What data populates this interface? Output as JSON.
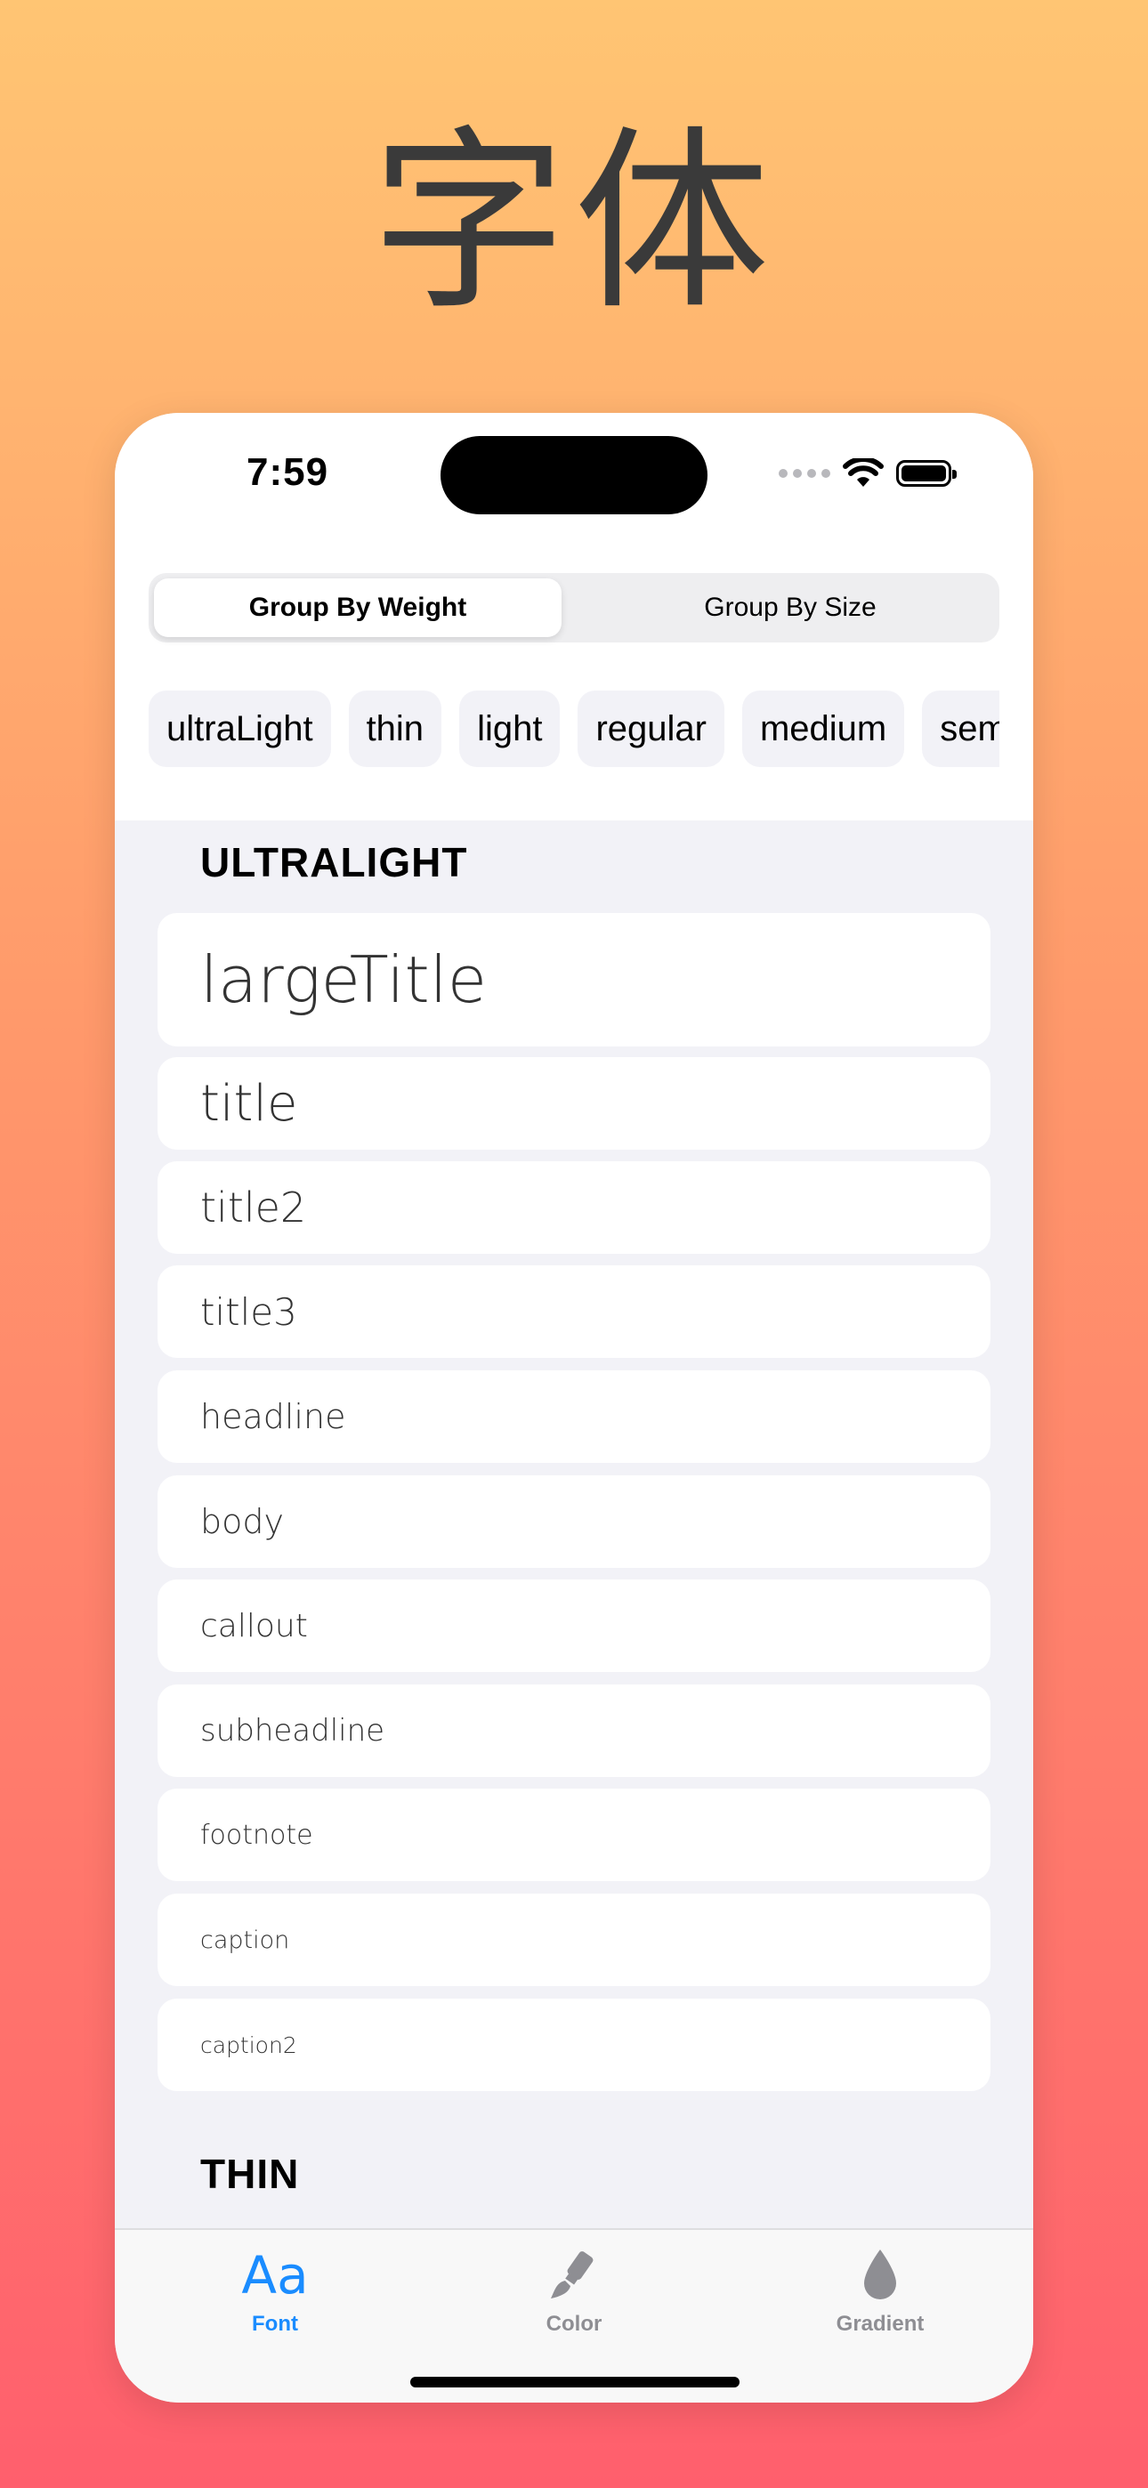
{
  "hero": {
    "title": "字体"
  },
  "status_bar": {
    "time": "7:59"
  },
  "segmented": {
    "left": "Group By Weight",
    "right": "Group By Size",
    "selected": "Group By Weight"
  },
  "weight_chips": [
    "ultraLight",
    "thin",
    "light",
    "regular",
    "medium",
    "semibold"
  ],
  "sections": [
    {
      "title": "ULTRALIGHT",
      "rows": [
        "largeTitle",
        "title",
        "title2",
        "title3",
        "headline",
        "body",
        "callout",
        "subheadline",
        "footnote",
        "caption",
        "caption2"
      ]
    },
    {
      "title": "THIN"
    }
  ],
  "tabbar": {
    "active": "Font",
    "accent_color": "#1A8CFF",
    "inactive_color": "#8E8E93",
    "tabs": [
      {
        "icon": "Aa",
        "label": "Font"
      },
      {
        "icon": "paintbrush-icon",
        "label": "Color"
      },
      {
        "icon": "drop-icon",
        "label": "Gradient"
      }
    ]
  }
}
